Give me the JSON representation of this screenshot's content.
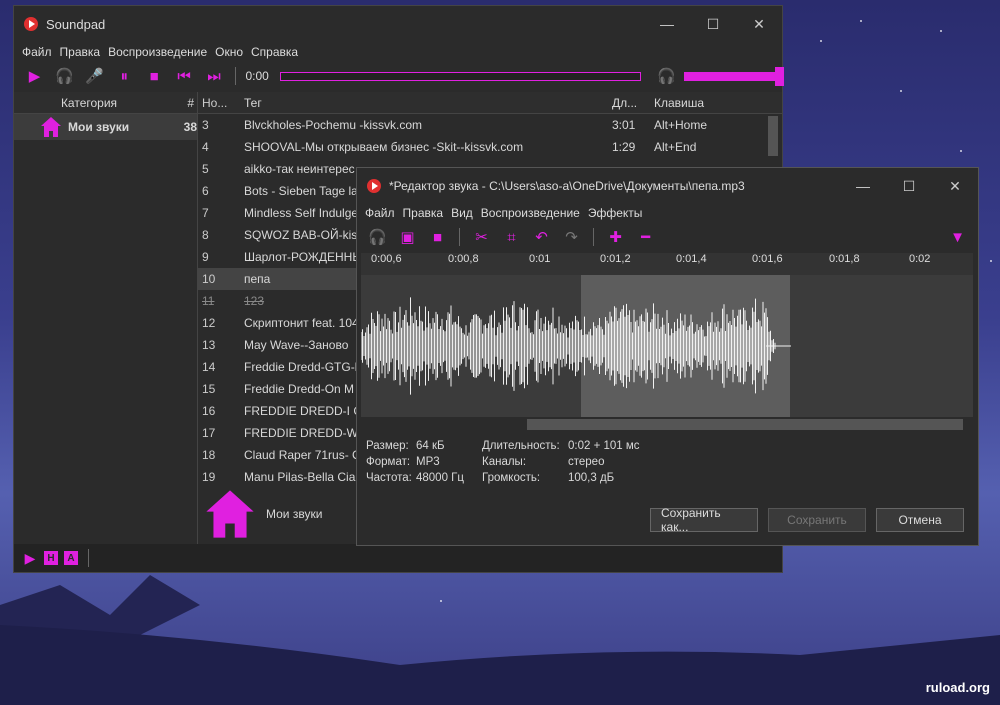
{
  "main": {
    "title": "Soundpad",
    "menu": [
      "Файл",
      "Правка",
      "Воспроизведение",
      "Окно",
      "Справка"
    ],
    "time": "0:00",
    "cat_headers": {
      "category": "Категория",
      "count": "#"
    },
    "category": {
      "name": "Мои звуки",
      "count": "38"
    },
    "list_headers": {
      "no": "Но...",
      "tag": "Тег",
      "dur": "Дл...",
      "key": "Клавиша"
    },
    "rows": [
      {
        "no": "3",
        "tag": "Blvckholes-Pochemu -kissvk.com",
        "dur": "3:01",
        "key": "Alt+Home"
      },
      {
        "no": "4",
        "tag": "SHOOVAL-Мы открываем бизнес -Skit--kissvk.com",
        "dur": "1:29",
        "key": "Alt+End"
      },
      {
        "no": "5",
        "tag": "aikko-так неинтерес",
        "dur": "",
        "key": ""
      },
      {
        "no": "6",
        "tag": "Bots - Sieben Tage la",
        "dur": "",
        "key": ""
      },
      {
        "no": "7",
        "tag": "Mindless Self Indulge",
        "dur": "",
        "key": ""
      },
      {
        "no": "8",
        "tag": "SQWOZ BAB-ОЙ-kis",
        "dur": "",
        "key": ""
      },
      {
        "no": "9",
        "tag": "Шарлот-РОЖДЕННЬ",
        "dur": "",
        "key": ""
      },
      {
        "no": "10",
        "tag": "пепа",
        "dur": "",
        "key": ""
      },
      {
        "no": "11",
        "tag": "123",
        "dur": "",
        "key": ""
      },
      {
        "no": "12",
        "tag": "Скриптонит feat. 104",
        "dur": "",
        "key": ""
      },
      {
        "no": "13",
        "tag": "May Wave--Заново",
        "dur": "",
        "key": ""
      },
      {
        "no": "14",
        "tag": "Freddie Dredd-GTG-k",
        "dur": "",
        "key": ""
      },
      {
        "no": "15",
        "tag": "Freddie Dredd-On M",
        "dur": "",
        "key": ""
      },
      {
        "no": "16",
        "tag": "FREDDIE DREDD-I GO",
        "dur": "",
        "key": ""
      },
      {
        "no": "17",
        "tag": "FREDDIE DREDD-WEA",
        "dur": "",
        "key": ""
      },
      {
        "no": "18",
        "tag": "Claud Raper 71rus- C",
        "dur": "",
        "key": ""
      },
      {
        "no": "19",
        "tag": "Manu Pilas-Bella Cia",
        "dur": "",
        "key": ""
      }
    ],
    "footer_label": "Мои звуки",
    "status_h": "H",
    "status_a": "A"
  },
  "editor": {
    "title": "*Редактор звука - C:\\Users\\aso-a\\OneDrive\\Документы\\пепа.mp3",
    "menu": [
      "Файл",
      "Правка",
      "Вид",
      "Воспроизведение",
      "Эффекты"
    ],
    "ruler": [
      "0:00,6",
      "0:00,8",
      "0:01",
      "0:01,2",
      "0:01,4",
      "0:01,6",
      "0:01,8",
      "0:02"
    ],
    "info": {
      "size_k": "Размер:",
      "size_v": "64 кБ",
      "format_k": "Формат:",
      "format_v": "MP3",
      "freq_k": "Частота:",
      "freq_v": "48000 Гц",
      "dur_k": "Длительность:",
      "dur_v": "0:02 + 101 мс",
      "ch_k": "Каналы:",
      "ch_v": "стерео",
      "vol_k": "Громкость:",
      "vol_v": "100,3 дБ"
    },
    "buttons": {
      "save_as": "Сохранить как...",
      "save": "Сохранить",
      "cancel": "Отмена"
    }
  },
  "watermark": "ruload.org",
  "colors": {
    "accent": "#e020e0",
    "window": "#2b2b2b",
    "waveform": "#ffffff"
  }
}
